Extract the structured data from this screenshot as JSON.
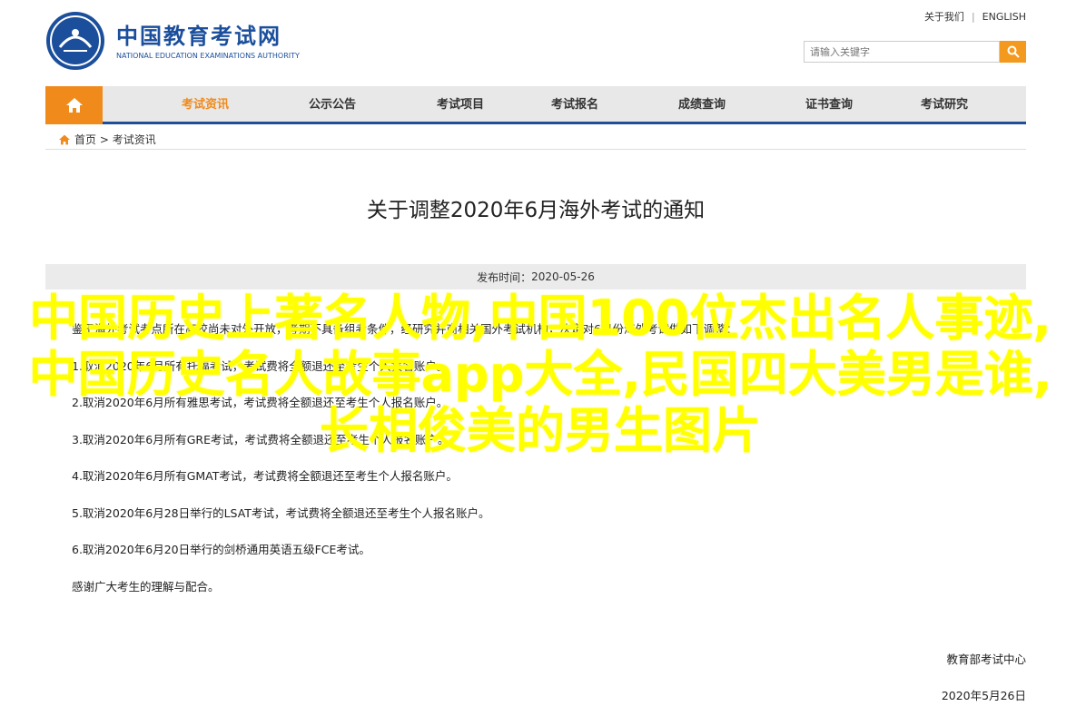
{
  "header": {
    "logo_cn": "中国教育考试网",
    "logo_en": "NATIONAL EDUCATION EXAMINATIONS AUTHORITY",
    "top_links": [
      "关于我们",
      "ENGLISH"
    ],
    "search_placeholder": "请输入关键字"
  },
  "nav": {
    "items": [
      "考试资讯",
      "公示公告",
      "考试项目",
      "考试报名",
      "成绩查询",
      "证书查询",
      "考试研究"
    ],
    "active": "考试资讯"
  },
  "breadcrumb": {
    "home": "首页",
    "separator": " > ",
    "current": "考试资讯"
  },
  "article": {
    "title": "关于调整2020年6月海外考试的通知",
    "publish_label": "发布时间：",
    "publish_date": "2020-05-26",
    "lines": [
      "鉴于海外考试考点所在高校尚未对外开放，考期不具备组考条件，经研究并商相关国外考试机构，决定对6月份海外考试做如下调整：",
      "1.取消2020年6月所有托福考试，考试费将全额退还至考生个人报名账户。",
      "2.取消2020年6月所有雅思考试，考试费将全额退还至考生个人报名账户。",
      "3.取消2020年6月所有GRE考试，考试费将全额退还至考生个人报名账户。",
      "4.取消2020年6月所有GMAT考试，考试费将全额退还至考生个人报名账户。",
      "5.取消2020年6月28日举行的LSAT考试，考试费将全额退还至考生个人报名账户。",
      "6.取消2020年6月20日举行的剑桥通用英语五级FCE考试。",
      "感谢广大考生的理解与配合。"
    ],
    "signature": "教育部考试中心",
    "sign_date": "2020年5月26日"
  },
  "overlay_text": "中国历史上著名人物,中国100位杰出名人事迹,中国历史名人故事app大全,民国四大美男是谁,长相俊美的男生图片",
  "colors": {
    "brand_blue": "#1f4f98",
    "accent_orange": "#f08a1a",
    "overlay_yellow": "#ffff00"
  }
}
